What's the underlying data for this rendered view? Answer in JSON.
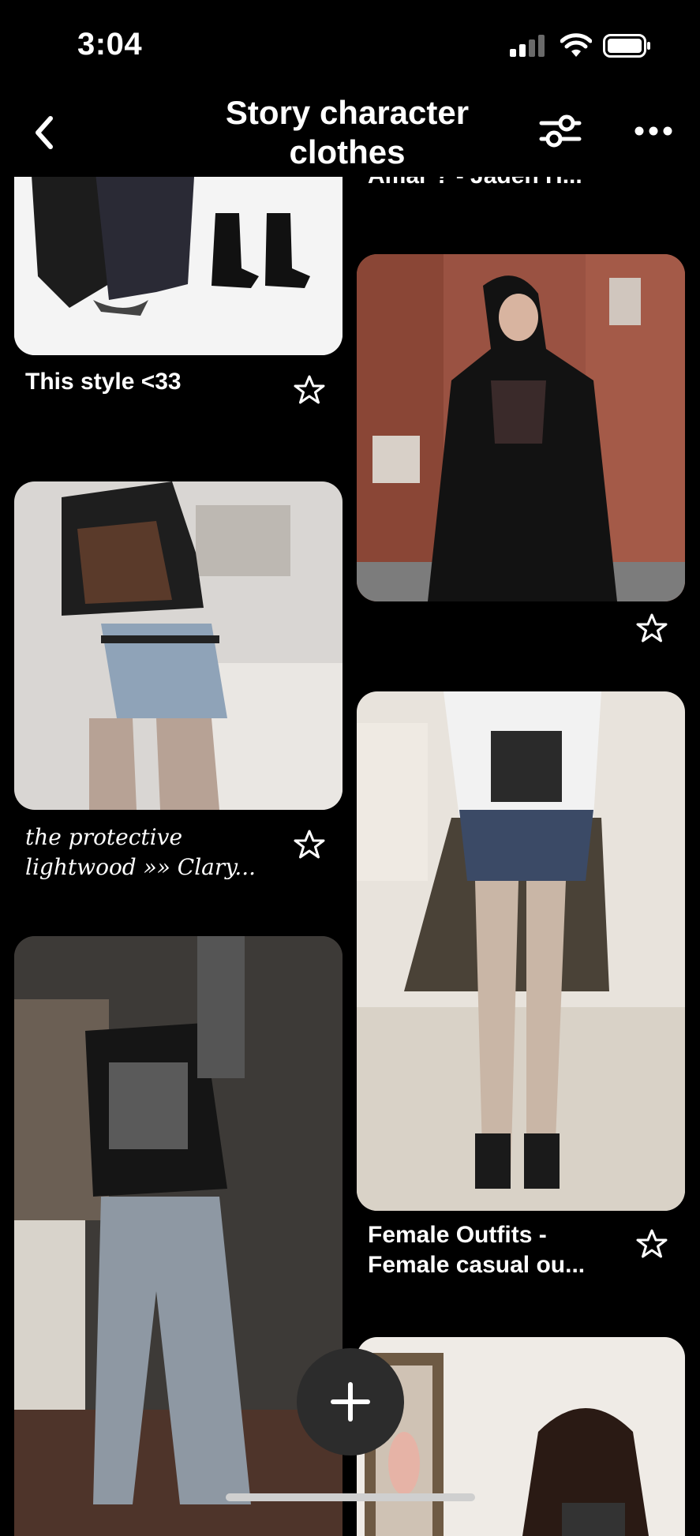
{
  "status_bar": {
    "time": "3:04"
  },
  "header": {
    "title": "Story character clothes"
  },
  "pins": [
    {
      "caption": "This style <33"
    },
    {
      "caption": "the protective lightwood »» Clary..."
    },
    {
      "caption": "Amar ? - Jaden H..."
    },
    {
      "caption": "Female Outfits  - Female casual ou..."
    }
  ],
  "colors": {
    "background": "#000000",
    "fab": "#2c2c2c",
    "text": "#ffffff"
  },
  "icons": {
    "back": "chevron-left-icon",
    "filter": "sliders-icon",
    "more": "ellipsis-icon",
    "save": "star-icon",
    "add": "plus-icon"
  }
}
